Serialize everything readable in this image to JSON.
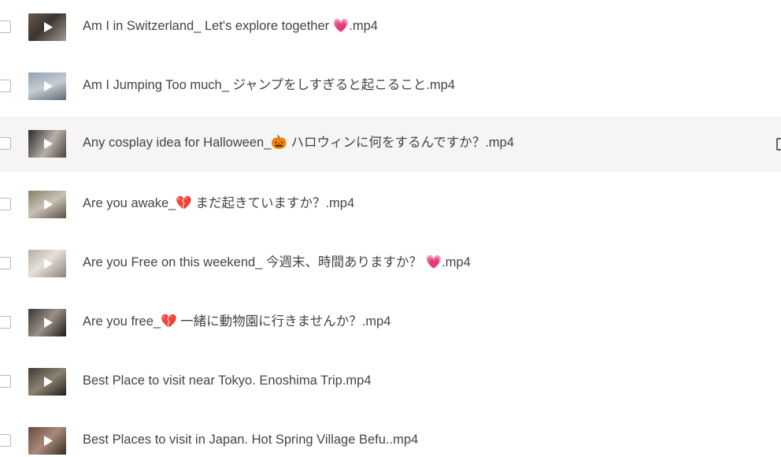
{
  "files": [
    {
      "name": "Am I in Switzerland_ Let's explore together 💗.mp4",
      "thumb_colors": [
        "#6a5a4e",
        "#3a3530",
        "#a39c92"
      ]
    },
    {
      "name": "Am I Jumping Too much_ ジャンプをしすぎると起こること.mp4",
      "thumb_colors": [
        "#8fa1b5",
        "#c7ccd2",
        "#5c6a7a"
      ]
    },
    {
      "name": "Any cosplay idea for Halloween_🎃 ハロウィンに何をするんですか？.mp4",
      "thumb_colors": [
        "#2e2a28",
        "#b8b0a8",
        "#4a4340"
      ]
    },
    {
      "name": "Are you awake_💔 まだ起きていますか？.mp4",
      "thumb_colors": [
        "#8a7f6e",
        "#c9c2b4",
        "#5a4f42"
      ]
    },
    {
      "name": "Are you Free on this weekend_ 今週末、時間ありますか？ 💗.mp4",
      "thumb_colors": [
        "#b2aba2",
        "#e6e1da",
        "#8b8178"
      ]
    },
    {
      "name": "Are you free_💔 一緒に動物園に行きませんか？.mp4",
      "thumb_colors": [
        "#3c3632",
        "#9a8f86",
        "#1e1b19"
      ]
    },
    {
      "name": "Best Place to visit near Tokyo. Enoshima Trip.mp4",
      "thumb_colors": [
        "#3d3a33",
        "#8c8272",
        "#22201c"
      ]
    },
    {
      "name": "Best Places to visit in Japan. Hot Spring Village Befu..mp4",
      "thumb_colors": [
        "#6b4a3e",
        "#a88a78",
        "#3e2c25"
      ]
    }
  ],
  "hovered_row_index": 2,
  "colors": {
    "text": "#444444",
    "hover_bg": "#f5f5f5",
    "checkbox_border": "#b9b9b9"
  },
  "icons": {
    "thumbnail_overlay": "play-icon",
    "row_action": "row-menu-icon"
  }
}
